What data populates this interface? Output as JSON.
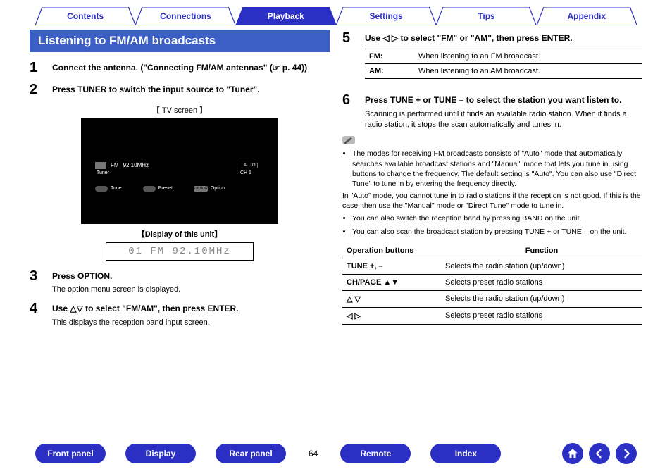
{
  "topnav": {
    "items": [
      {
        "label": "Contents",
        "active": false
      },
      {
        "label": "Connections",
        "active": false
      },
      {
        "label": "Playback",
        "active": true
      },
      {
        "label": "Settings",
        "active": false
      },
      {
        "label": "Tips",
        "active": false
      },
      {
        "label": "Appendix",
        "active": false
      }
    ]
  },
  "section_title": "Listening to FM/AM broadcasts",
  "steps_left": [
    {
      "n": "1",
      "title": "Connect the antenna. (\"Connecting FM/AM antennas\" (☞ p. 44))",
      "desc": ""
    },
    {
      "n": "2",
      "title": "Press TUNER to switch the input source to \"Tuner\".",
      "desc": ""
    },
    {
      "n": "3",
      "title": "Press OPTION.",
      "desc": "The option menu screen is displayed."
    },
    {
      "n": "4",
      "title": "Use △▽ to select \"FM/AM\", then press ENTER.",
      "desc": "This displays the reception band input screen."
    }
  ],
  "tv_label": "【 TV screen 】",
  "tv": {
    "source": "Tuner",
    "band": "FM",
    "freq": "92.10MHz",
    "auto": "AUTO",
    "ch": "CH 1",
    "tune": "Tune",
    "preset": "Preset",
    "option": "Option",
    "option_btn": "OPTION"
  },
  "display_label": "【Display of this unit】",
  "lcd_text": "01 FM  92.10MHz",
  "steps_right": [
    {
      "n": "5",
      "title": "Use ◁ ▷ to select \"FM\" or \"AM\", then press ENTER.",
      "desc": ""
    },
    {
      "n": "6",
      "title": "Press TUNE + or TUNE – to select the station you want listen to.",
      "desc": "Scanning is performed until it finds an available radio station. When it finds a radio station, it stops the scan automatically and tunes in."
    }
  ],
  "fmam_table": [
    {
      "k": "FM:",
      "v": "When listening to an FM broadcast."
    },
    {
      "k": "AM:",
      "v": "When listening to an AM broadcast."
    }
  ],
  "notes": [
    "The modes for receiving FM broadcasts consists of \"Auto\" mode that automatically searches available broadcast stations and \"Manual\" mode that lets you tune in using buttons to change the frequency. The default setting is \"Auto\". You can also use \"Direct Tune\" to tune in by entering the frequency directly.",
    "In \"Auto\" mode, you cannot tune in to radio stations if the reception is not good. If this is the case, then use the \"Manual\" mode or \"Direct Tune\" mode to tune in.",
    "You can also switch the reception band by pressing BAND on the unit.",
    "You can also scan the broadcast station by pressing TUNE + or TUNE – on the unit."
  ],
  "ops_header": {
    "a": "Operation buttons",
    "b": "Function"
  },
  "ops": [
    {
      "a": "TUNE +, –",
      "b": "Selects the radio station (up/down)"
    },
    {
      "a": "CH/PAGE ▲▼",
      "b": "Selects preset radio stations"
    },
    {
      "a": "△ ▽",
      "b": "Selects the radio station (up/down)"
    },
    {
      "a": "◁ ▷",
      "b": "Selects preset radio stations"
    }
  ],
  "footer": {
    "buttons": [
      "Front panel",
      "Display",
      "Rear panel",
      "Remote",
      "Index"
    ],
    "page": "64"
  }
}
